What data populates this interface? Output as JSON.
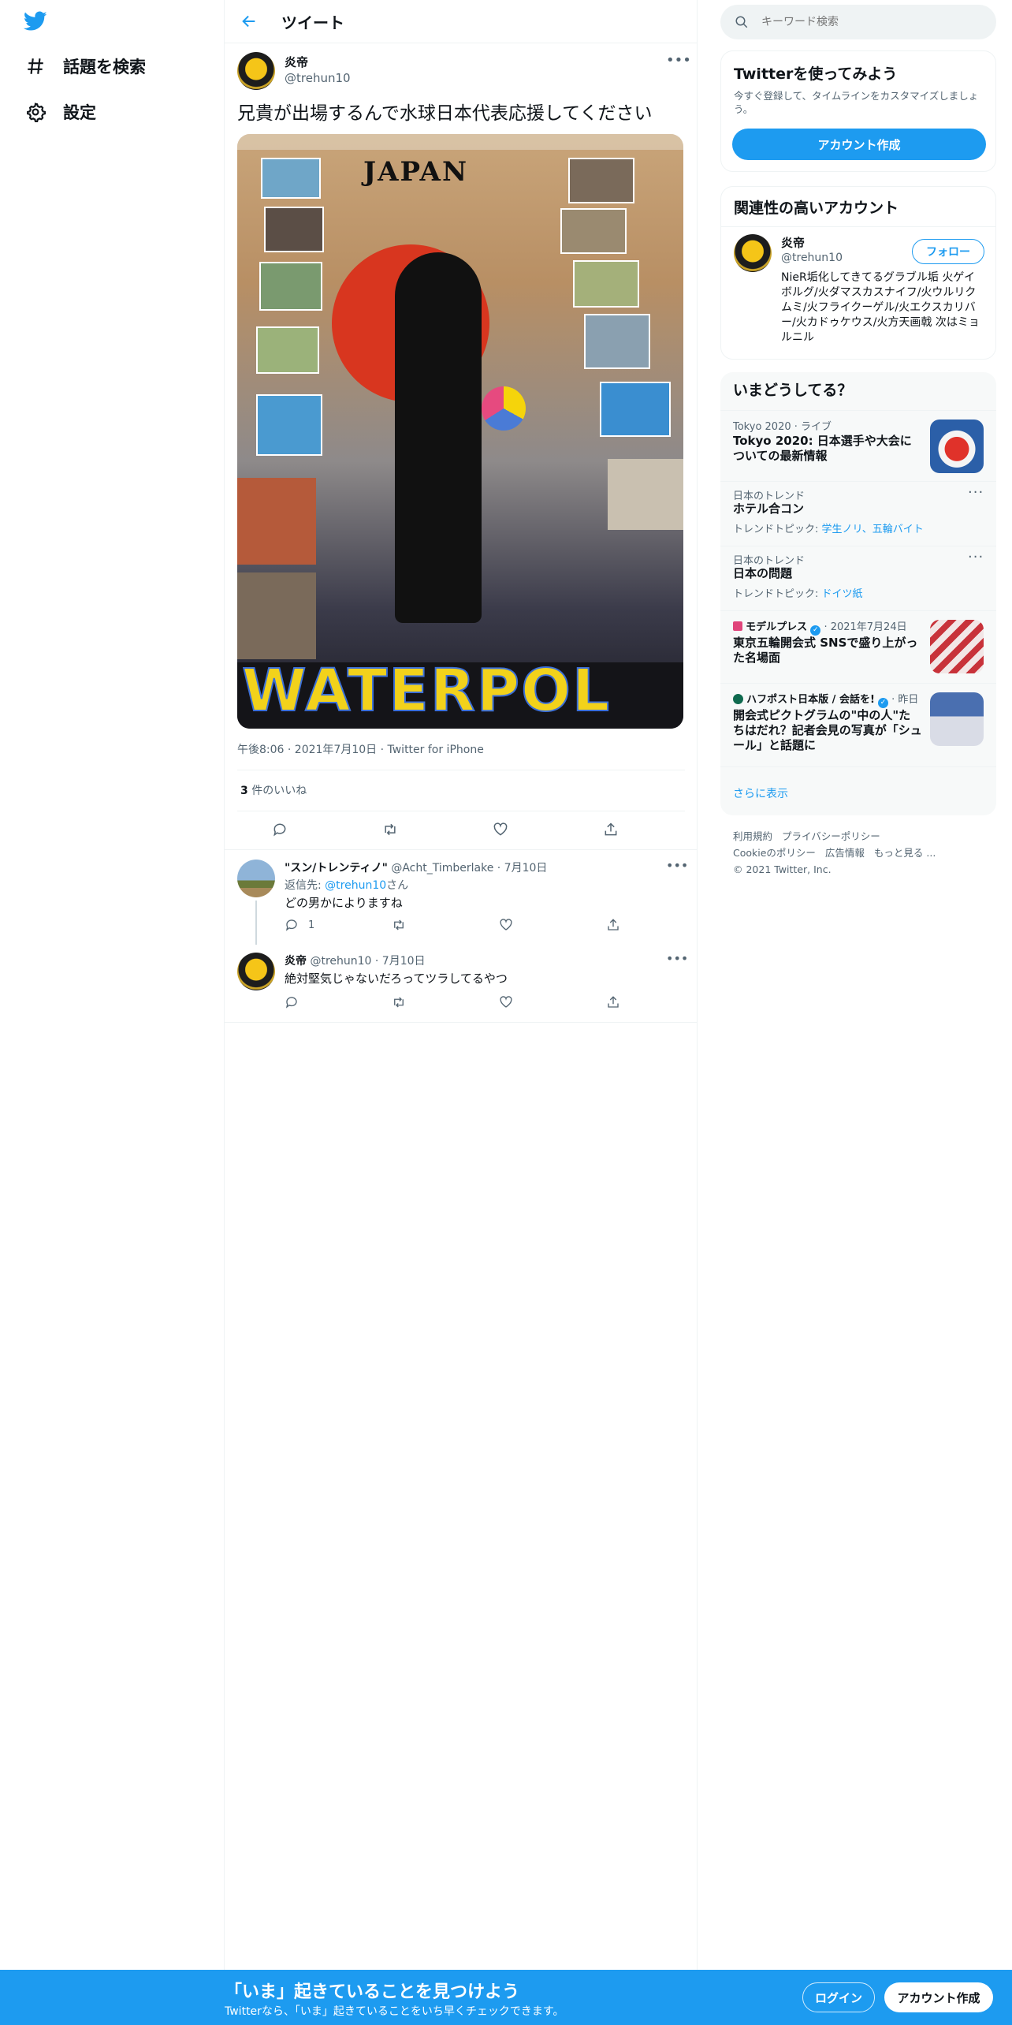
{
  "nav": {
    "explore_label": "話題を検索",
    "settings_label": "設定"
  },
  "header": {
    "title": "ツイート"
  },
  "tweet": {
    "author_name": "炎帝",
    "author_handle": "@trehun10",
    "text": "兄貴が出場するんで水球日本代表応援してください",
    "image_text_top": "JAPAN",
    "image_text_bottom": "WATERPOL",
    "timestamp": "午後8:06 · 2021年7月10日 · Twitter for iPhone",
    "likes_count": "3",
    "likes_label": " 件のいいね"
  },
  "replies": [
    {
      "name": "\"スン/トレンティノ\"",
      "handle": "@Acht_Timberlake",
      "date": "· 7月10日",
      "reply_to_prefix": "返信先: ",
      "reply_to_handle": "@trehun10",
      "reply_to_suffix": "さん",
      "text": "どの男かによりますね",
      "reply_count": "1"
    },
    {
      "name": "炎帝",
      "handle": "@trehun10",
      "date": "· 7月10日",
      "text": "絶対堅気じゃないだろってツラしてるやつ"
    }
  ],
  "search": {
    "placeholder": "キーワード検索"
  },
  "signup": {
    "title": "Twitterを使ってみよう",
    "desc": "今すぐ登録して、タイムラインをカスタマイズしましょう。",
    "button": "アカウント作成"
  },
  "related": {
    "title": "関連性の高いアカウント",
    "name": "炎帝",
    "handle": "@trehun10",
    "follow": "フォロー",
    "bio": "NieR垢化してきてるグラブル垢 火ゲイボルグ/火ダマスカスナイフ/火ウルリクムミ/火フライクーゲル/火エクスカリバー/火カドゥケウス/火方天画戟 次はミョルニル"
  },
  "trends": {
    "title": "いまどうしてる？",
    "items": [
      {
        "meta": "Tokyo 2020 · ライブ",
        "title": "Tokyo 2020: 日本選手や大会についての最新情報"
      },
      {
        "meta": "日本のトレンド",
        "title": "ホテル合コン",
        "topics_label": "トレンドトピック: ",
        "topics": "学生ノリ、五輪バイト"
      },
      {
        "meta": "日本のトレンド",
        "title": "日本の問題",
        "topics_label": "トレンドトピック: ",
        "topics": "ドイツ紙"
      },
      {
        "source": "モデルプレス",
        "meta": "· 2021年7月24日",
        "title": "東京五輪開会式 SNSで盛り上がった名場面"
      },
      {
        "source": "ハフポスト日本版 / 会話を!",
        "meta": "· 昨日",
        "title": "開会式ピクトグラムの\"中の人\"たちはだれ？記者会見の写真が「シュール」と話題に"
      }
    ],
    "show_more": "さらに表示"
  },
  "footer": {
    "line1": [
      "利用規約",
      "プライバシーポリシー"
    ],
    "line2": [
      "Cookieのポリシー",
      "広告情報",
      "もっと見る ..."
    ],
    "copyright": "© 2021 Twitter, Inc."
  },
  "bottom_bar": {
    "title": "「いま」起きていることを見つけよう",
    "subtitle": "Twitterなら、「いま」起きていることをいち早くチェックできます。",
    "login": "ログイン",
    "signup": "アカウント作成"
  },
  "colors": {
    "accent": "#1d9bf0",
    "text": "#0f1419",
    "muted": "#536471"
  }
}
